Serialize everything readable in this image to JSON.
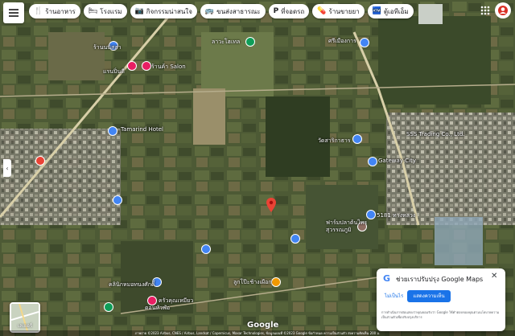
{
  "chips": [
    {
      "icon": "restaurant-icon",
      "glyph": "🍴",
      "label": "ร้านอาหาร"
    },
    {
      "icon": "hotel-icon",
      "glyph": "🛏",
      "label": "โรงแรม"
    },
    {
      "icon": "camera-icon",
      "glyph": "📷",
      "label": "กิจกรรมน่าสนใจ"
    },
    {
      "icon": "transit-icon",
      "glyph": "🚌",
      "label": "ขนส่งสาธารณะ"
    },
    {
      "icon": "parking-icon",
      "glyph": "P",
      "label": "ที่จอดรถ"
    },
    {
      "icon": "pharmacy-icon",
      "glyph": "💊",
      "label": "ร้านขายยา"
    },
    {
      "icon": "atm-icon",
      "glyph": "🏧",
      "label": "ตู้เอทีเอ็ม"
    }
  ],
  "map_labels": {
    "l1": "ร้านนนิสสา",
    "l2": "ร้านค้า Salon",
    "l3": "แรนปิ่นดี",
    "l4": "ลาวะโฮเทล",
    "l5": "ศรีเมืองการ",
    "l6": "Tamarind Hotel",
    "l7": "วัดสาริกาธาร",
    "l8": "SSS Trading Co., Ltd.",
    "l9": "Gateway City",
    "l10": "ฟาร์มปลาต้นไทร",
    "l11": "สุวรรณภูมิ",
    "l12": "5181 ทางหลวง",
    "l13": "ลูกโป๊ะช้างเผือก",
    "l14": "คลินิกหมอทนงศักดิ์",
    "l15": "ครัวคุณเหมียว",
    "l16": "ดอนหัวฬ่อ"
  },
  "popup": {
    "title": "ช่วยเราปรับปรุง Google Maps",
    "no_label": "ไม่เป็นไร",
    "yes_label": "แสดงความเห็น",
    "fine_print": "การดำเนินการต่อแสดงว่าคุณยอมรับว่า Google ใช้คำตอบของคุณตามนโยบายความเป็นส่วนตัวเพื่อปรับปรุงบริการ"
  },
  "layers_label": "เลเยอร์",
  "google_logo": "Google",
  "footer_text": "ภาพถ่าย ©2023 Airbus, CNES / Airbus, Landsat / Copernicus, Maxar Technologies, ข้อมูลแผนที่ ©2023 Google   ข้อกำหนด   ความเป็นส่วนตัว   ส่งความคิดเห็น   200 ม."
}
